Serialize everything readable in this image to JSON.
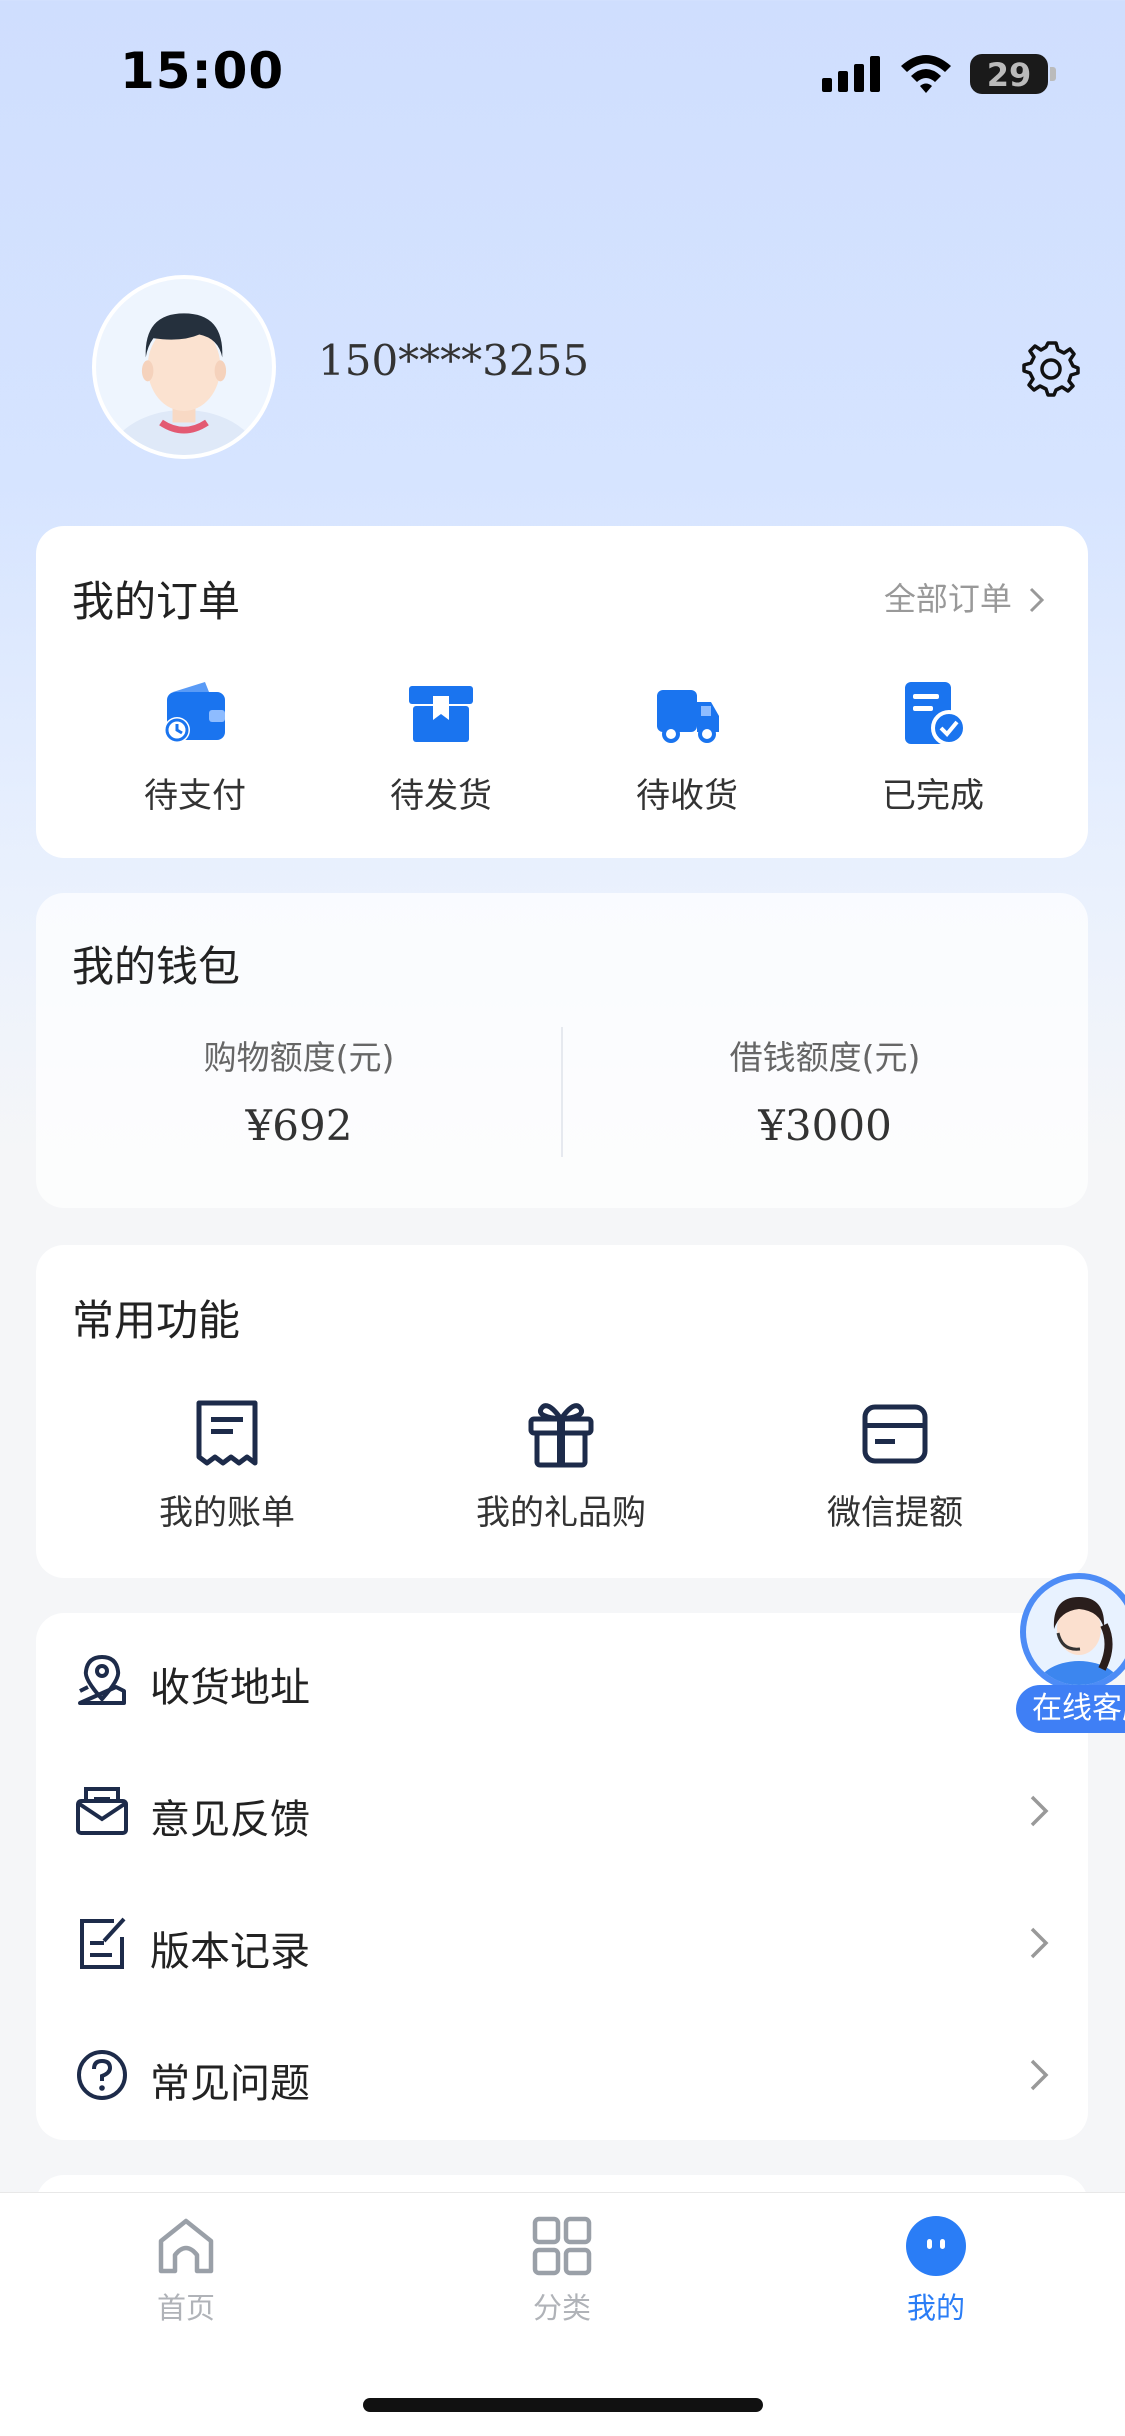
{
  "status_bar": {
    "time": "15:00",
    "battery": "29"
  },
  "profile": {
    "phone": "150****3255"
  },
  "orders": {
    "title": "我的订单",
    "all_label": "全部订单",
    "items": [
      {
        "label": "待支付",
        "icon": "wallet-clock-icon"
      },
      {
        "label": "待发货",
        "icon": "box-icon"
      },
      {
        "label": "待收货",
        "icon": "truck-icon"
      },
      {
        "label": "已完成",
        "icon": "document-check-icon"
      }
    ]
  },
  "wallet": {
    "title": "我的钱包",
    "shopping": {
      "label": "购物额度(元)",
      "value": "¥692"
    },
    "borrow": {
      "label": "借钱额度(元)",
      "value": "¥3000"
    }
  },
  "functions": {
    "title": "常用功能",
    "items": [
      {
        "label": "我的账单",
        "icon": "receipt-icon"
      },
      {
        "label": "我的礼品购",
        "icon": "gift-icon"
      },
      {
        "label": "微信提额",
        "icon": "card-icon"
      }
    ]
  },
  "menu": {
    "items": [
      {
        "label": "收货地址",
        "icon": "map-pin-icon"
      },
      {
        "label": "意见反馈",
        "icon": "envelope-icon"
      },
      {
        "label": "版本记录",
        "icon": "edit-note-icon"
      },
      {
        "label": "常见问题",
        "icon": "question-circle-icon"
      }
    ]
  },
  "customer_service": {
    "label": "在线客服"
  },
  "tabbar": {
    "items": [
      {
        "label": "首页",
        "icon": "home-icon",
        "active": false
      },
      {
        "label": "分类",
        "icon": "grid-icon",
        "active": false
      },
      {
        "label": "我的",
        "icon": "profile-face-icon",
        "active": true
      }
    ],
    "active_color": "#2a7df6",
    "inactive_color": "#b0b3b8"
  },
  "colors": {
    "accent": "#2a7df6",
    "icon_blue": "#1a74ef",
    "icon_dark": "#1d2b4a"
  }
}
